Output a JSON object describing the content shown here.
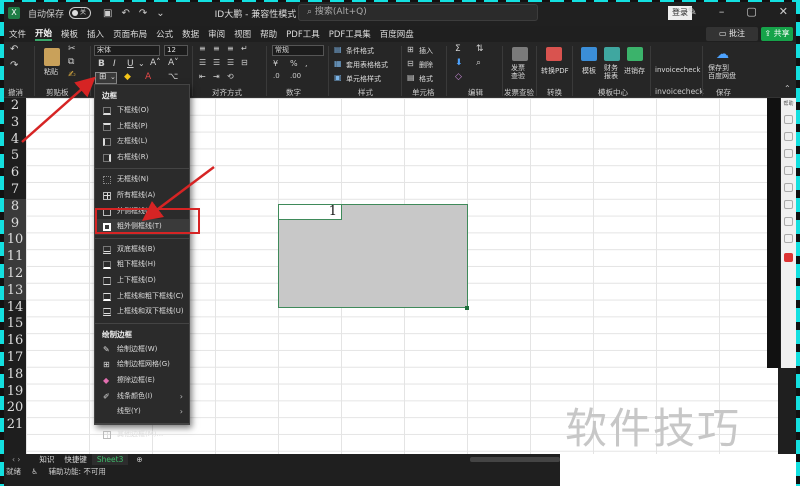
{
  "titlebar": {
    "autosave_label": "自动保存",
    "toggle_state": "关",
    "doc_title": "ID大鹏 - 兼容性模式 -",
    "search_placeholder": "搜索(Alt+Q)",
    "login_label": "登录"
  },
  "menu": {
    "tabs": [
      "文件",
      "开始",
      "模板",
      "插入",
      "页面布局",
      "公式",
      "数据",
      "审阅",
      "视图",
      "帮助",
      "PDF工具",
      "PDF工具集",
      "百度网盘"
    ],
    "active_index": 1,
    "comment_label": "批注",
    "share_label": "共享"
  },
  "ribbon": {
    "undo_label": "撤消",
    "paste_label": "粘贴",
    "clipboard_label": "剪贴板",
    "font_name": "宋体",
    "font_size": "12",
    "align_label": "对齐方式",
    "number_label": "数字",
    "number_format": "常规",
    "styles_label": "样式",
    "cond_format_label": "条件格式",
    "table_format_label": "套用表格格式",
    "cell_style_label": "单元格样式",
    "cells_label": "单元格",
    "insert_label": "插入",
    "delete_label": "删除",
    "format_label": "格式",
    "edit_label": "编辑",
    "invoice_check_label": "发票查验",
    "invoice_btn": "发票\n查验",
    "convert_label": "转换",
    "convert_pdf_btn": "转换PDF",
    "template_center_label": "模板中心",
    "template_btn": "模板",
    "finance_btn": "财务\n报表",
    "progress_btn": "进销存",
    "invoicecheck_btn": "invoicecheck",
    "invoicecheck_label": "invoicecheck",
    "save_btn": "保存到\n百度网盘",
    "save_label": "保存"
  },
  "rows": [
    "2",
    "3",
    "4",
    "5",
    "6",
    "7",
    "8",
    "9",
    "10",
    "11",
    "12",
    "13",
    "14",
    "15",
    "16",
    "17",
    "18",
    "19",
    "20",
    "21"
  ],
  "cell_value": "1",
  "border_menu": {
    "header_borders": "边框",
    "items_borders": [
      "下框线(O)",
      "上框线(P)",
      "左框线(L)",
      "右框线(R)",
      "无框线(N)",
      "所有框线(A)",
      "外侧框线(S)",
      "粗外侧框线(T)",
      "双底框线(B)",
      "粗下框线(H)",
      "上下框线(D)",
      "上框线和粗下框线(C)",
      "上框线和双下框线(U)"
    ],
    "header_draw": "绘制边框",
    "items_draw": [
      "绘制边框(W)",
      "绘制边框网格(G)",
      "擦除边框(E)",
      "线条颜色(I)",
      "线型(Y)",
      "其他边框(M)..."
    ],
    "highlighted_item": "粗外侧框线(T)"
  },
  "sheet_tabs": [
    "知识",
    "快捷键",
    "Sheet3"
  ],
  "active_sheet": "Sheet3",
  "status": {
    "ready": "就绪",
    "accessibility": "辅助功能: 不可用"
  },
  "side_panel_labels": [
    "帮助"
  ],
  "watermark": "软件技巧"
}
